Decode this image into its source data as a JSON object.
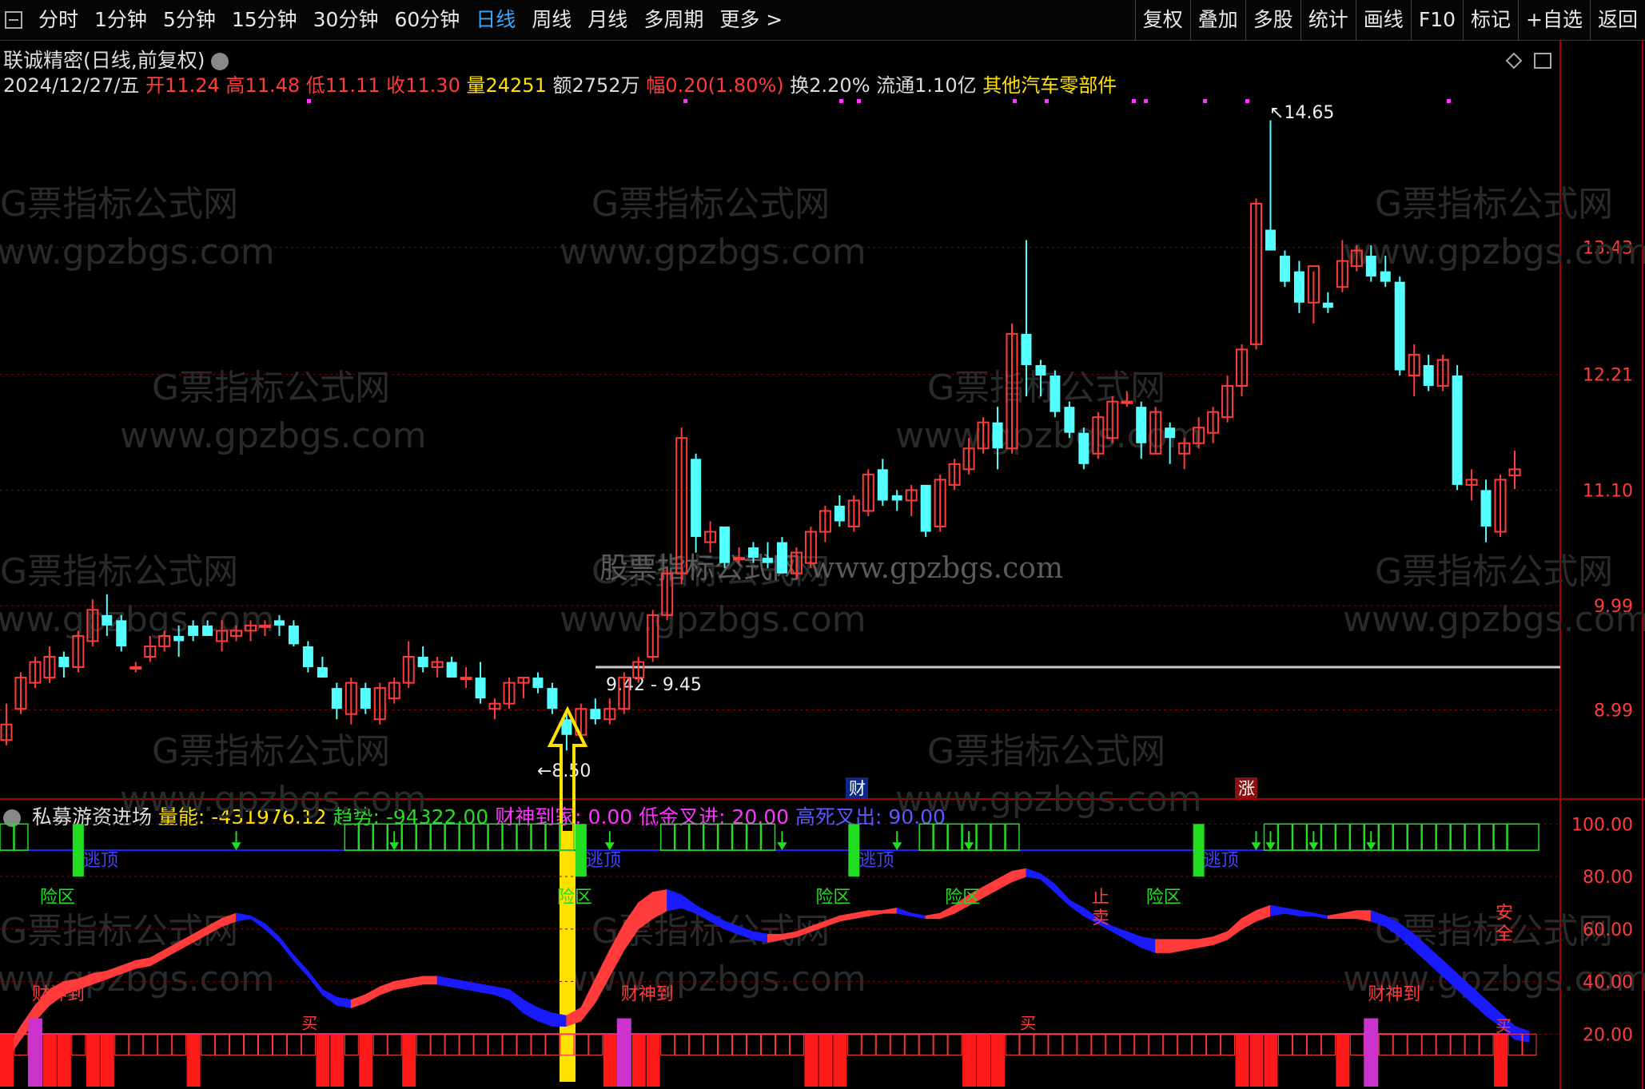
{
  "toolbar": {
    "periods": [
      "分时",
      "1分钟",
      "5分钟",
      "15分钟",
      "30分钟",
      "60分钟",
      "日线",
      "周线",
      "月线",
      "多周期",
      "更多 >"
    ],
    "active_period": "日线",
    "right_buttons": [
      "复权",
      "叠加",
      "多股",
      "统计",
      "画线",
      "F10",
      "标记",
      "+自选",
      "返回"
    ]
  },
  "header": {
    "title": "联诚精密(日线,前复权)",
    "date": "2024/12/27/五",
    "open": "开11.24",
    "high": "高11.48",
    "low": "低11.11",
    "close": "收11.30",
    "volume": "量24251",
    "amount": "额2752万",
    "change": "幅0.20(1.80%)",
    "turnover": "换2.20%",
    "float": "流通1.10亿",
    "sector": "其他汽车零部件"
  },
  "indicator": {
    "name": "私募游资进场",
    "volume_energy": "量能: -431976.12",
    "trend": "趋势: -94322.00",
    "wealth": "财神到家: 0.00",
    "low_cross": "低金叉进: 20.00",
    "high_cross": "高死叉出: 90.00"
  },
  "colors": {
    "up": "#ff3b3b",
    "down": "#54ffff",
    "ma": "#ffffff",
    "grid": "#8b0000",
    "accent_yellow": "#ffe100",
    "purple": "#ff33ff",
    "blue": "#1a1aff",
    "green": "#22dd22"
  },
  "chart_data": [
    {
      "type": "candlestick",
      "title": "联诚精密(日线,前复权)",
      "y_ticks": [
        13.43,
        12.21,
        11.1,
        9.99,
        8.99
      ],
      "ylim": [
        8.15,
        14.9
      ],
      "annotations": {
        "high_label": "14.65",
        "low_label": "8.50",
        "range_label": "9.42 - 9.45",
        "tag_finance": "财",
        "tag_rise": "涨",
        "watermarks": [
          "G票指标公式网",
          "www.gpzbgs.com",
          "股票指标公式网 www.gpzbgs.com"
        ]
      },
      "candles": [
        [
          8.7,
          9.05,
          8.65,
          8.85
        ],
        [
          9.0,
          9.35,
          8.95,
          9.3
        ],
        [
          9.25,
          9.5,
          9.2,
          9.45
        ],
        [
          9.3,
          9.6,
          9.25,
          9.5
        ],
        [
          9.5,
          9.55,
          9.3,
          9.4
        ],
        [
          9.4,
          9.75,
          9.35,
          9.7
        ],
        [
          9.65,
          10.05,
          9.6,
          9.95
        ],
        [
          9.9,
          10.1,
          9.7,
          9.8
        ],
        [
          9.85,
          9.9,
          9.55,
          9.6
        ],
        [
          9.4,
          9.45,
          9.35,
          9.4
        ],
        [
          9.5,
          9.7,
          9.45,
          9.6
        ],
        [
          9.6,
          9.75,
          9.55,
          9.7
        ],
        [
          9.7,
          9.8,
          9.5,
          9.65
        ],
        [
          9.8,
          9.85,
          9.65,
          9.7
        ],
        [
          9.8,
          9.85,
          9.7,
          9.7
        ],
        [
          9.65,
          9.85,
          9.55,
          9.75
        ],
        [
          9.7,
          9.8,
          9.65,
          9.75
        ],
        [
          9.75,
          9.85,
          9.65,
          9.8
        ],
        [
          9.8,
          9.85,
          9.7,
          9.8
        ],
        [
          9.85,
          9.9,
          9.7,
          9.8
        ],
        [
          9.8,
          9.85,
          9.6,
          9.62
        ],
        [
          9.6,
          9.65,
          9.35,
          9.4
        ],
        [
          9.4,
          9.5,
          9.3,
          9.3
        ],
        [
          9.2,
          9.25,
          8.9,
          9.0
        ],
        [
          8.95,
          9.3,
          8.85,
          9.25
        ],
        [
          9.2,
          9.25,
          8.95,
          9.0
        ],
        [
          8.9,
          9.25,
          8.85,
          9.2
        ],
        [
          9.1,
          9.3,
          9.05,
          9.25
        ],
        [
          9.25,
          9.65,
          9.2,
          9.5
        ],
        [
          9.5,
          9.6,
          9.35,
          9.4
        ],
        [
          9.4,
          9.5,
          9.3,
          9.45
        ],
        [
          9.45,
          9.5,
          9.3,
          9.3
        ],
        [
          9.3,
          9.4,
          9.2,
          9.3
        ],
        [
          9.3,
          9.45,
          9.05,
          9.1
        ],
        [
          9.0,
          9.1,
          8.9,
          9.05
        ],
        [
          9.05,
          9.3,
          9.0,
          9.25
        ],
        [
          9.25,
          9.3,
          9.1,
          9.3
        ],
        [
          9.3,
          9.35,
          9.15,
          9.2
        ],
        [
          9.2,
          9.25,
          8.95,
          9.0
        ],
        [
          8.9,
          8.95,
          8.6,
          8.75
        ],
        [
          8.75,
          9.05,
          8.7,
          9.0
        ],
        [
          9.0,
          9.1,
          8.85,
          8.9
        ],
        [
          8.9,
          9.1,
          8.85,
          9.0
        ],
        [
          9.0,
          9.35,
          8.95,
          9.3
        ],
        [
          9.3,
          9.5,
          9.25,
          9.45
        ],
        [
          9.5,
          9.95,
          9.45,
          9.9
        ],
        [
          9.9,
          10.35,
          9.85,
          10.3
        ],
        [
          10.3,
          11.7,
          10.2,
          11.6
        ],
        [
          11.4,
          11.45,
          10.5,
          10.65
        ],
        [
          10.6,
          10.8,
          10.5,
          10.7
        ],
        [
          10.75,
          10.75,
          10.35,
          10.4
        ],
        [
          10.45,
          10.55,
          10.4,
          10.45
        ],
        [
          10.55,
          10.6,
          10.4,
          10.45
        ],
        [
          10.45,
          10.6,
          10.35,
          10.4
        ],
        [
          10.6,
          10.65,
          10.3,
          10.3
        ],
        [
          10.3,
          10.55,
          10.25,
          10.5
        ],
        [
          10.4,
          10.75,
          10.35,
          10.7
        ],
        [
          10.7,
          10.95,
          10.6,
          10.9
        ],
        [
          10.95,
          11.05,
          10.75,
          10.8
        ],
        [
          10.75,
          11.05,
          10.7,
          11.0
        ],
        [
          10.9,
          11.3,
          10.85,
          11.25
        ],
        [
          11.3,
          11.4,
          10.95,
          11.0
        ],
        [
          11.05,
          11.1,
          10.9,
          11.0
        ],
        [
          11.0,
          11.15,
          10.85,
          11.1
        ],
        [
          11.15,
          11.15,
          10.65,
          10.7
        ],
        [
          10.75,
          11.25,
          10.7,
          11.2
        ],
        [
          11.15,
          11.4,
          11.1,
          11.35
        ],
        [
          11.3,
          11.6,
          11.25,
          11.5
        ],
        [
          11.5,
          11.8,
          11.45,
          11.75
        ],
        [
          11.75,
          11.9,
          11.3,
          11.5
        ],
        [
          11.5,
          12.7,
          11.45,
          12.6
        ],
        [
          12.6,
          13.5,
          12.0,
          12.3
        ],
        [
          12.3,
          12.35,
          12.0,
          12.2
        ],
        [
          12.2,
          12.25,
          11.8,
          11.85
        ],
        [
          11.9,
          11.95,
          11.6,
          11.65
        ],
        [
          11.65,
          11.7,
          11.3,
          11.35
        ],
        [
          11.45,
          11.85,
          11.4,
          11.8
        ],
        [
          11.6,
          12.0,
          11.55,
          11.95
        ],
        [
          11.95,
          12.05,
          11.9,
          11.95
        ],
        [
          11.9,
          11.95,
          11.4,
          11.55
        ],
        [
          11.45,
          11.9,
          11.45,
          11.85
        ],
        [
          11.7,
          11.75,
          11.35,
          11.6
        ],
        [
          11.45,
          11.6,
          11.3,
          11.55
        ],
        [
          11.55,
          11.8,
          11.5,
          11.7
        ],
        [
          11.65,
          11.9,
          11.55,
          11.85
        ],
        [
          11.8,
          12.2,
          11.75,
          12.1
        ],
        [
          12.1,
          12.5,
          12.0,
          12.45
        ],
        [
          12.5,
          13.9,
          12.45,
          13.85
        ],
        [
          13.6,
          14.65,
          13.5,
          13.4
        ],
        [
          13.35,
          13.4,
          13.05,
          13.1
        ],
        [
          13.2,
          13.3,
          12.8,
          12.9
        ],
        [
          12.9,
          13.2,
          12.7,
          13.25
        ],
        [
          12.9,
          13.0,
          12.8,
          12.85
        ],
        [
          13.05,
          13.5,
          13.0,
          13.3
        ],
        [
          13.25,
          13.45,
          13.2,
          13.4
        ],
        [
          13.35,
          13.45,
          13.1,
          13.15
        ],
        [
          13.2,
          13.35,
          13.05,
          13.1
        ],
        [
          13.1,
          13.15,
          12.2,
          12.25
        ],
        [
          12.2,
          12.5,
          12.0,
          12.4
        ],
        [
          12.3,
          12.4,
          12.05,
          12.1
        ],
        [
          12.1,
          12.4,
          12.05,
          12.35
        ],
        [
          12.2,
          12.3,
          11.1,
          11.15
        ],
        [
          11.15,
          11.3,
          11.0,
          11.2
        ],
        [
          11.1,
          11.2,
          10.6,
          10.75
        ],
        [
          10.7,
          11.25,
          10.65,
          11.2
        ],
        [
          11.24,
          11.48,
          11.11,
          11.3
        ]
      ]
    },
    {
      "type": "area",
      "title": "私募游资进场",
      "y_ticks": [
        100.0,
        80.0,
        60.0,
        40.0,
        20.0
      ],
      "ylim": [
        0,
        108
      ],
      "labels": {
        "escape_top": "逃顶",
        "danger": "险区",
        "wealth": "财神到",
        "buy": "买",
        "stop_sell": "止卖",
        "safe": "安全"
      },
      "trend_upper": [
        14,
        23,
        31,
        37,
        40,
        41,
        43,
        44,
        46,
        48,
        49,
        52,
        55,
        58,
        61,
        64,
        66,
        65,
        62,
        57,
        50,
        44,
        37,
        34,
        33,
        35,
        38,
        40,
        41,
        42,
        42,
        41,
        40,
        39,
        38,
        37,
        33,
        30,
        28,
        27,
        30,
        41,
        52,
        62,
        70,
        74,
        75,
        73,
        69,
        66,
        63,
        61,
        59,
        58,
        58,
        59,
        61,
        63,
        65,
        66,
        67,
        67,
        68,
        66,
        65,
        66,
        69,
        73,
        76,
        79,
        82,
        83,
        81,
        77,
        71,
        68,
        64,
        61,
        59,
        57,
        56,
        56,
        56,
        56,
        57,
        59,
        64,
        67,
        69,
        68,
        67,
        66,
        65,
        66,
        67,
        67,
        65,
        62,
        58,
        53,
        48,
        43,
        38,
        33,
        28,
        23,
        21
      ],
      "trend_lower": [
        10,
        18,
        25,
        31,
        35,
        37,
        39,
        41,
        43,
        45,
        46,
        49,
        52,
        55,
        58,
        61,
        63,
        64,
        60,
        55,
        48,
        42,
        35,
        31,
        30,
        32,
        35,
        37,
        38,
        39,
        39,
        38,
        37,
        36,
        35,
        33,
        28,
        25,
        23,
        23,
        25,
        32,
        42,
        52,
        60,
        64,
        67,
        68,
        66,
        63,
        60,
        58,
        56,
        55,
        56,
        57,
        59,
        61,
        63,
        64,
        65,
        66,
        66,
        65,
        64,
        64,
        66,
        69,
        72,
        75,
        78,
        80,
        79,
        74,
        69,
        65,
        62,
        59,
        56,
        53,
        51,
        51,
        52,
        53,
        54,
        56,
        60,
        63,
        65,
        66,
        65,
        65,
        64,
        64,
        64,
        63,
        61,
        57,
        52,
        47,
        42,
        37,
        32,
        27,
        23,
        18,
        17
      ],
      "wealth_bars": [
        2,
        43,
        95
      ],
      "escape_top": [
        5,
        40,
        59,
        83
      ],
      "sell_arrows": [
        16,
        27,
        42,
        54,
        62,
        67,
        87,
        88,
        91,
        95
      ],
      "volume_bars": [
        1,
        0,
        1,
        1,
        1,
        0,
        1,
        1,
        0,
        0,
        0,
        0,
        0,
        1,
        0,
        0,
        0,
        0,
        0,
        0,
        0,
        0,
        1,
        1,
        0,
        1,
        0,
        0,
        1,
        0,
        0,
        0,
        0,
        0,
        0,
        0,
        0,
        0,
        0,
        0,
        0,
        0,
        1,
        1,
        1,
        1,
        0,
        0,
        0,
        0,
        0,
        0,
        0,
        0,
        0,
        0,
        1,
        1,
        1,
        0,
        0,
        0,
        0,
        0,
        0,
        0,
        0,
        1,
        1,
        1,
        0,
        0,
        0,
        0,
        0,
        0,
        0,
        0,
        0,
        0,
        0,
        0,
        0,
        0,
        0,
        0,
        1,
        1,
        1,
        0,
        0,
        0,
        0,
        1,
        0,
        0,
        0,
        0,
        0,
        0,
        0,
        0,
        0,
        0,
        1,
        0,
        0
      ]
    }
  ]
}
